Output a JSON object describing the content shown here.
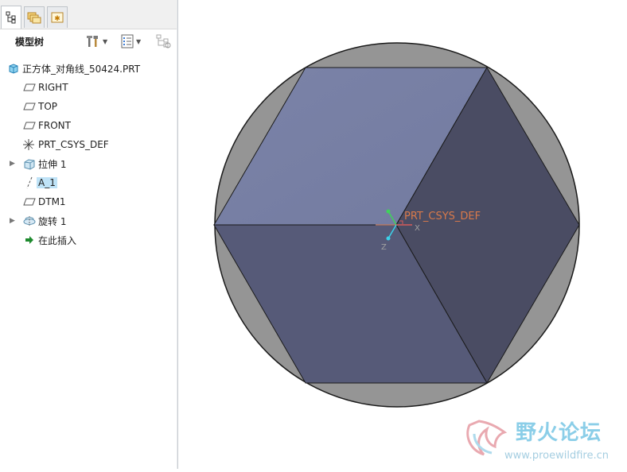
{
  "tabs": [
    {
      "name": "model-tree-tab",
      "icon": "model-tree-icon",
      "active": true
    },
    {
      "name": "folder-browser-tab",
      "icon": "folder-icon",
      "active": false
    },
    {
      "name": "favorites-tab",
      "icon": "favorites-icon",
      "active": false
    }
  ],
  "toolbar": {
    "title": "模型树",
    "settings_icon": "tools-icon",
    "show_icon": "list-icon",
    "filter_icon": "tree-filter-icon"
  },
  "tree": {
    "items": [
      {
        "label": "正方体_对角线_50424.PRT",
        "icon": "part-icon",
        "expandable": false
      },
      {
        "label": "RIGHT",
        "icon": "datum-plane-icon",
        "expandable": false
      },
      {
        "label": "TOP",
        "icon": "datum-plane-icon",
        "expandable": false
      },
      {
        "label": "FRONT",
        "icon": "datum-plane-icon",
        "expandable": false
      },
      {
        "label": "PRT_CSYS_DEF",
        "icon": "coordinate-system-icon",
        "expandable": false
      },
      {
        "label": "拉伸 1",
        "icon": "extrude-icon",
        "expandable": true
      },
      {
        "label": "A_1",
        "icon": "datum-axis-icon",
        "expandable": false,
        "selected": true
      },
      {
        "label": "DTM1",
        "icon": "datum-plane-icon",
        "expandable": false
      },
      {
        "label": "旋转 1",
        "icon": "revolve-icon",
        "expandable": true
      },
      {
        "label": "在此插入",
        "icon": "insert-arrow-icon",
        "expandable": false
      }
    ]
  },
  "viewport": {
    "csys_label": "PRT_CSYS_DEF",
    "axis_x": "X",
    "axis_z": "Z",
    "colors": {
      "disc": "#959595",
      "face_top": "#7880a5",
      "face_left": "#565a78",
      "face_right": "#4a4c63",
      "csys_label": "#d97a4a"
    }
  },
  "watermark": {
    "title": "野火论坛",
    "url": "www.proewildfire.cn"
  }
}
